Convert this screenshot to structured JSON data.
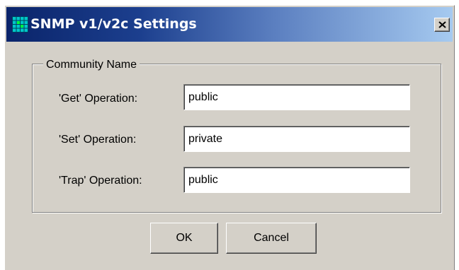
{
  "window": {
    "title": "SNMP v1/v2c Settings",
    "title_icon": "grid-app-icon",
    "close_icon": "close-icon"
  },
  "group": {
    "legend": "Community Name"
  },
  "fields": [
    {
      "label": "'Get' Operation:",
      "value": "public"
    },
    {
      "label": "'Set' Operation:",
      "value": "private"
    },
    {
      "label": "'Trap' Operation:",
      "value": "public"
    }
  ],
  "buttons": {
    "ok_label": "OK",
    "cancel_label": "Cancel"
  },
  "colors": {
    "titlebar_start": "#0a246a",
    "titlebar_end": "#a6caf0",
    "dialog_face": "#d4d0c8"
  }
}
